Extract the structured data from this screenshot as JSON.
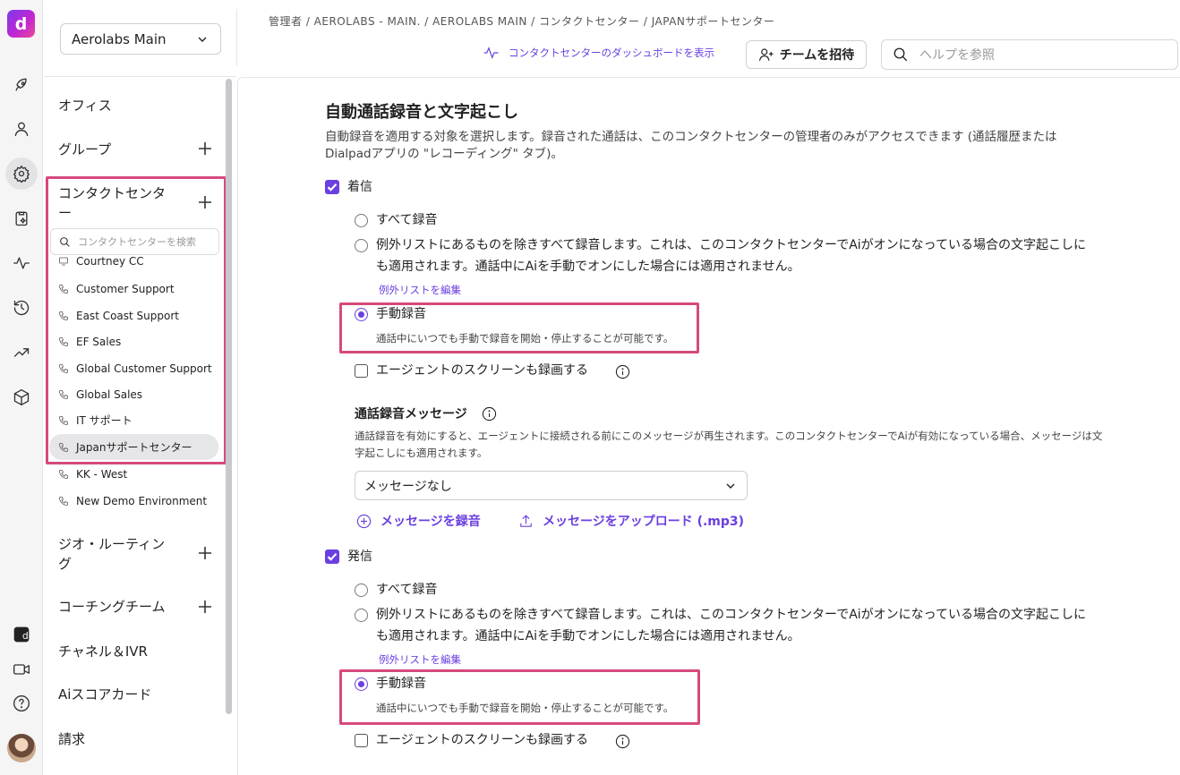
{
  "rail": {
    "logo_letter": "d",
    "icons": [
      "rocket-icon",
      "person-icon",
      "gear-icon",
      "clipboard-icon",
      "activity-icon",
      "history-icon",
      "trending-icon",
      "cube-icon"
    ],
    "bottom_icons": [
      "dialpad-ai-icon",
      "video-icon",
      "help-icon"
    ]
  },
  "sidebar": {
    "workspace": "Aerolabs Main",
    "sections": {
      "office": "オフィス",
      "groups": "グループ",
      "contact_centers": "コンタクトセンター",
      "geo_routing": "ジオ・ルーティング",
      "coaching": "コーチングチーム",
      "channels": "チャネル＆IVR",
      "ai_scorecard": "Aiスコアカード",
      "billing": "請求"
    },
    "cc_search_placeholder": "コンタクトセンターを検索",
    "cc_items": [
      {
        "label": "Courtney CC",
        "icon": "monitor-icon"
      },
      {
        "label": "Customer Support",
        "icon": "phone-icon"
      },
      {
        "label": "East Coast Support",
        "icon": "phone-icon"
      },
      {
        "label": "EF Sales",
        "icon": "phone-icon"
      },
      {
        "label": "Global Customer Support",
        "icon": "phone-icon"
      },
      {
        "label": "Global Sales",
        "icon": "phone-icon"
      },
      {
        "label": "IT サポート",
        "icon": "phone-icon"
      },
      {
        "label": "Japanサポートセンター",
        "icon": "phone-icon",
        "active": true
      },
      {
        "label": "KK - West",
        "icon": "phone-icon"
      },
      {
        "label": "New Demo Environment",
        "icon": "phone-icon"
      }
    ]
  },
  "header": {
    "breadcrumb": "管理者 / AEROLABS - MAIN. / AEROLABS MAIN / コンタクトセンター / JAPANサポートセンター",
    "dashboard_link": "コンタクトセンターのダッシュボードを表示",
    "invite_button": "チームを招待",
    "help_placeholder": "ヘルプを参照"
  },
  "main": {
    "title": "自動通話録音と文字起こし",
    "description_line1": "自動録音を適用する対象を選択します。録音された通話は、このコンタクトセンターの管理者のみがアクセスできます (通話履歴または",
    "description_line2": "Dialpadアプリの \"レコーディング\" タブ)。",
    "incoming": {
      "label": "着信",
      "checked": true,
      "opt_all": "すべて録音",
      "opt_except_line1": "例外リストにあるものを除きすべて録音します。これは、このコンタクトセンターでAiがオンになっている場合の文字起こしに",
      "opt_except_line2": "も適用されます。通話中にAiを手動でオンにした場合には適用されません。",
      "edit_exceptions": "例外リストを編集",
      "opt_manual": "手動録音",
      "opt_manual_hint": "通話中にいつでも手動で録音を開始・停止することが可能です。",
      "selected": "手動録音",
      "screen_record": "エージェントのスクリーンも録画する"
    },
    "message": {
      "title": "通話録音メッセージ",
      "desc_line1": "通話録音を有効にすると、エージェントに接続される前にこのメッセージが再生されます。このコンタクトセンターでAiが有効になっている場合、メッセージは文",
      "desc_line2": "字起こしにも適用されます。",
      "select_value": "メッセージなし",
      "record_link": "メッセージを録音",
      "upload_link": "メッセージをアップロード (.mp3)"
    },
    "outgoing": {
      "label": "発信",
      "checked": true,
      "opt_all": "すべて録音",
      "opt_except_line1": "例外リストにあるものを除きすべて録音します。これは、このコンタクトセンターでAiがオンになっている場合の文字起こしに",
      "opt_except_line2": "も適用されます。通話中にAiを手動でオンにした場合には適用されません。",
      "edit_exceptions": "例外リストを編集",
      "opt_manual": "手動録音",
      "opt_manual_hint": "通話中にいつでも手動で録音を開始・停止することが可能です。",
      "selected": "手動録音",
      "screen_record": "エージェントのスクリーンも録画する"
    }
  },
  "colors": {
    "accent": "#6b3fe0",
    "highlight": "#d6497d"
  }
}
